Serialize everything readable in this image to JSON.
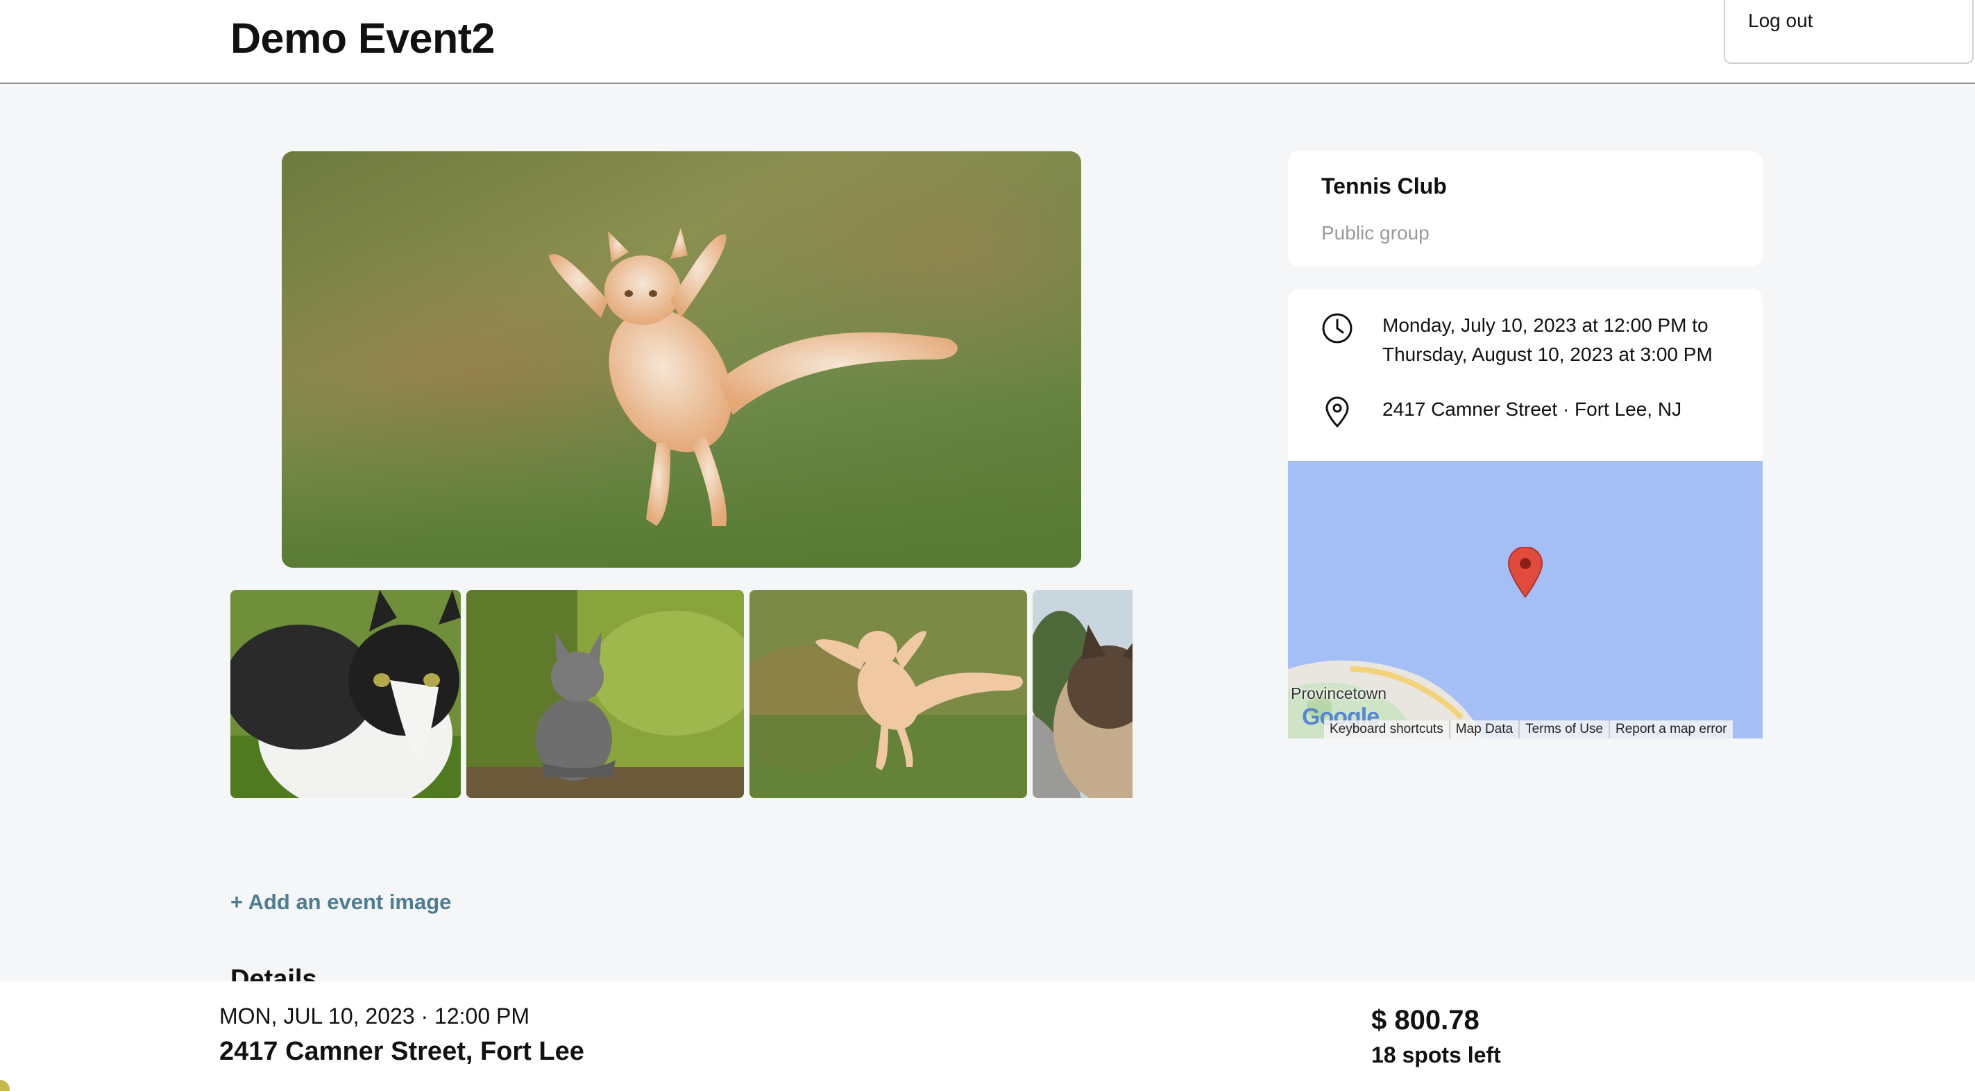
{
  "header": {
    "title": "Demo Event2",
    "logout_label": "Log out"
  },
  "gallery": {
    "main_image": "jumping-ginger-cat-photo",
    "thumbnails": [
      "black-white-cat-photo",
      "grey-kitten-photo",
      "jumping-ginger-cat-photo",
      "siamese-cat-photo"
    ],
    "add_image_label": "+ Add an event image"
  },
  "details_heading": "Details",
  "group": {
    "name": "Tennis Club",
    "type": "Public group"
  },
  "info": {
    "date_line1": "Monday, July 10, 2023 at 12:00 PM to",
    "date_line2": "Thursday, August 10, 2023 at 3:00 PM",
    "address": "2417 Camner Street · Fort Lee, NJ"
  },
  "map": {
    "town_label": "Provincetown",
    "logo_text": "Google",
    "footer_links": [
      "Keyboard shortcuts",
      "Map Data",
      "Terms of Use",
      "Report a map error"
    ],
    "water_color": "#a4bef6",
    "pin_color": "#e04b3c"
  },
  "bottom_bar": {
    "date": "MON, JUL 10, 2023 · 12:00 PM",
    "address": "2417 Camner Street, Fort Lee",
    "price": "$ 800.78",
    "spots": "18 spots left"
  },
  "colors": {
    "accent_link": "#4c7d92",
    "page_bg": "#f5f6f7"
  }
}
